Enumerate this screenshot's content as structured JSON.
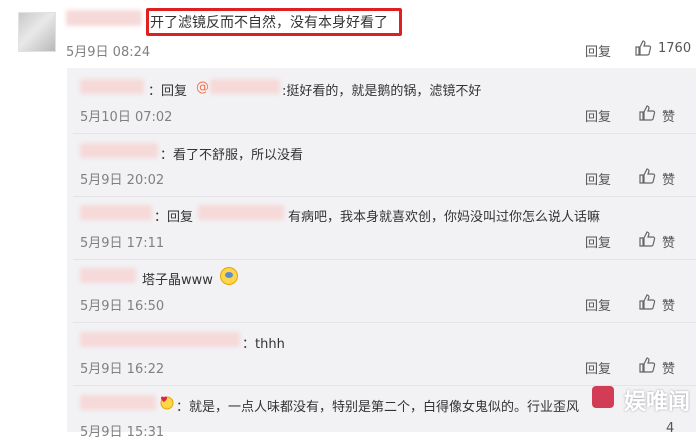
{
  "main_comment": {
    "text": "开了滤镜反而不自然，没有本身好看了",
    "date": "5月9日 08:24",
    "reply_label": "回复",
    "like_count": "1760"
  },
  "replies": [
    {
      "prefix": "：回复",
      "mention": "@",
      "body": ":挺好看的，就是鹅的锅，滤镜不好",
      "date": "5月10日 07:02",
      "reply_label": "回复",
      "like_label": "赞"
    },
    {
      "prefix": "",
      "mention": "",
      "body": "：看了不舒服，所以没看",
      "date": "5月9日 20:02",
      "reply_label": "回复",
      "like_label": "赞"
    },
    {
      "prefix": "：回复",
      "mention": "",
      "body": "有病吧，我本身就喜欢创，你妈没叫过你怎么说人话嘛",
      "date": "5月9日 17:11",
      "reply_label": "回复",
      "like_label": "赞"
    },
    {
      "prefix": "",
      "mention": "",
      "body": "塔子晶www",
      "date": "5月9日 16:50",
      "reply_label": "回复",
      "like_label": "赞"
    },
    {
      "prefix": "",
      "mention": "",
      "body": "：thhh",
      "date": "5月9日 16:22",
      "reply_label": "回复",
      "like_label": "赞"
    },
    {
      "prefix": "",
      "mention": "",
      "body": "：就是，一点人味都没有，特别是第二个，白得像女鬼似的。行业歪风",
      "date": "5月9日 15:31",
      "reply_label": "回复",
      "like_label": "4"
    }
  ],
  "watermark": "娱唯闻",
  "colors": {
    "highlight_border": "#e02020",
    "link": "#eb7350",
    "reply_bg": "#f2f2f5"
  }
}
